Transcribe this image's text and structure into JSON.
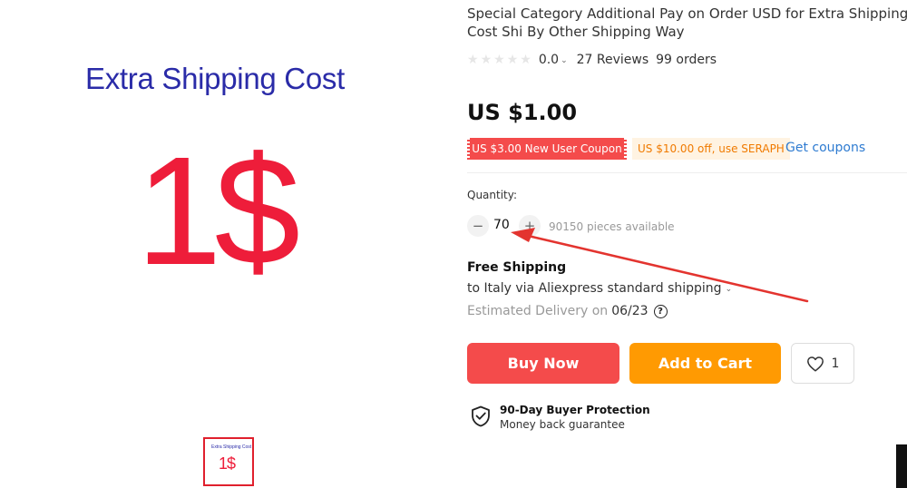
{
  "product_image": {
    "title": "Extra Shipping Cost",
    "price_text": "1$"
  },
  "thumbnail": {
    "title": "Extra Shipping Cost",
    "price_text": "1$"
  },
  "product": {
    "title": "Special Category Additional Pay on Order USD for Extra Shipping Cost Shi By Other Shipping Way",
    "rating": {
      "score": "0.0",
      "reviews": "27 Reviews",
      "orders": "99 orders"
    },
    "price": "US $1.00"
  },
  "coupons": {
    "new_user": "US $3.00 New User Coupon",
    "promo": "US $10.00 off, use SERAPH",
    "get_link": "Get coupons"
  },
  "quantity": {
    "label": "Quantity:",
    "value": "70",
    "minus": "−",
    "plus": "+",
    "available": "90150 pieces available"
  },
  "shipping": {
    "title": "Free Shipping",
    "method": "to Italy via Aliexpress standard shipping",
    "delivery_label": "Estimated Delivery on",
    "delivery_date": "06/23"
  },
  "actions": {
    "buy_now": "Buy Now",
    "add_to_cart": "Add to Cart",
    "wishlist_count": "1"
  },
  "protection": {
    "title": "90-Day Buyer Protection",
    "subtitle": "Money back guarantee"
  },
  "colors": {
    "accent_red": "#f44b4b",
    "cart_orange": "#ff9a02",
    "link_blue": "#2e7bd1",
    "annotation_arrow": "#e3342f"
  }
}
